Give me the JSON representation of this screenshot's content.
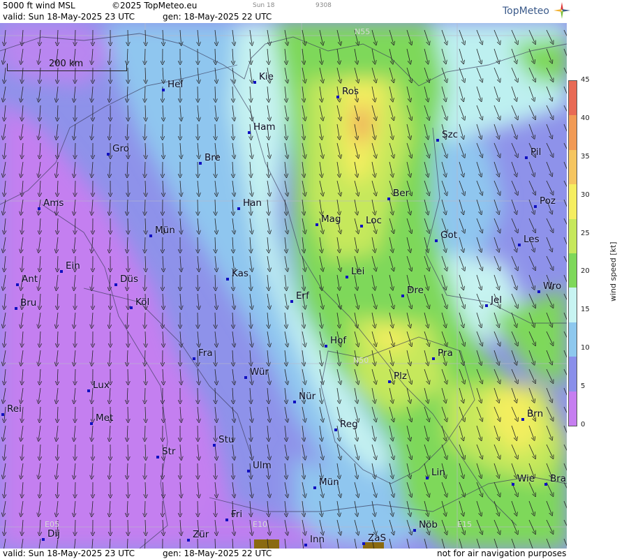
{
  "header": {
    "title": "5000 ft wind MSL",
    "copyright": "©2025 TopMeteo.eu",
    "day_tag": "Sun 18",
    "code": "9308",
    "valid": "valid:  Sun  18-May-2025  23 UTC",
    "gen": "gen: 18-May-2025  22 UTC",
    "logo": "TopMeteo"
  },
  "footer": {
    "valid": "valid:  Sun  18-May-2025  23 UTC",
    "gen": "gen: 18-May-2025  22 UTC",
    "disclaimer": "not for air navigation purposes"
  },
  "scale": {
    "label": "200 km"
  },
  "grid_labels": {
    "n55": "N55",
    "n50": "N50",
    "e05": "E05",
    "e10": "E10",
    "e15": "E15"
  },
  "colorbar": {
    "title": "wind speed  [kt]",
    "ticks": [
      "45",
      "40",
      "35",
      "30",
      "25",
      "20",
      "15",
      "10",
      "5",
      "0"
    ],
    "colors": [
      "#e86a55",
      "#f19a55",
      "#f5c560",
      "#f5ee60",
      "#c6e85c",
      "#7ed85a",
      "#c8f4f2",
      "#8ec8ee",
      "#8a8fea",
      "#c67ef0"
    ]
  },
  "cities": [
    {
      "name": "Kie"
    },
    {
      "name": "Hel"
    },
    {
      "name": "Ros"
    },
    {
      "name": "Ham"
    },
    {
      "name": "Szc"
    },
    {
      "name": "Gro"
    },
    {
      "name": "Bre"
    },
    {
      "name": "Pil"
    },
    {
      "name": "Ber"
    },
    {
      "name": "Ams"
    },
    {
      "name": "Han"
    },
    {
      "name": "Poz"
    },
    {
      "name": "Mag"
    },
    {
      "name": "Loc"
    },
    {
      "name": "Mün"
    },
    {
      "name": "Got"
    },
    {
      "name": "Les"
    },
    {
      "name": "Ein"
    },
    {
      "name": "Kas"
    },
    {
      "name": "Lei"
    },
    {
      "name": "Ant"
    },
    {
      "name": "Düs"
    },
    {
      "name": "Dre"
    },
    {
      "name": "Wro"
    },
    {
      "name": "Erf"
    },
    {
      "name": "Bru"
    },
    {
      "name": "Köl"
    },
    {
      "name": "Jel"
    },
    {
      "name": "Hof"
    },
    {
      "name": "Fra"
    },
    {
      "name": "Pra"
    },
    {
      "name": "Wür"
    },
    {
      "name": "Plz"
    },
    {
      "name": "Lux"
    },
    {
      "name": "Rei"
    },
    {
      "name": "Nür"
    },
    {
      "name": "Met"
    },
    {
      "name": "Brn"
    },
    {
      "name": "Reg"
    },
    {
      "name": "Stu"
    },
    {
      "name": "Str"
    },
    {
      "name": "Ulm"
    },
    {
      "name": "Lin"
    },
    {
      "name": "Wie"
    },
    {
      "name": "Bra"
    },
    {
      "name": "Mün"
    },
    {
      "name": "Fri"
    },
    {
      "name": "Nöb"
    },
    {
      "name": "Dij"
    },
    {
      "name": "Zür"
    },
    {
      "name": "Inn"
    },
    {
      "name": "ZaS"
    }
  ]
}
